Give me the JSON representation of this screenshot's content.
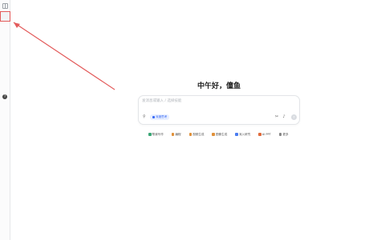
{
  "sidebar": {
    "toggle_icon": "sidebar-toggle-icon",
    "help_icon": "help-icon"
  },
  "main": {
    "greeting": "中午好，僮鱼"
  },
  "composer": {
    "placeholder": "发消息或输入 / 选择技能",
    "mode_label": "深度思考",
    "icons": [
      "attach-icon",
      "scissors-icon",
      "mic-icon",
      "send-icon"
    ]
  },
  "quick_actions": [
    {
      "label": "帮我写作",
      "color": "#3aa675"
    },
    {
      "label": "编程",
      "color": "#e0913a"
    },
    {
      "label": "视频生成",
      "color": "#e0913a"
    },
    {
      "label": "图像生成",
      "color": "#e0913a"
    },
    {
      "label": "深入研究",
      "color": "#4a7cf0"
    },
    {
      "label": "AI PPT",
      "color": "#e06a3a"
    },
    {
      "label": "更多",
      "color": "#888888"
    }
  ],
  "colors": {
    "accent": "#3b6cf6",
    "annotation": "#e35b5b"
  }
}
